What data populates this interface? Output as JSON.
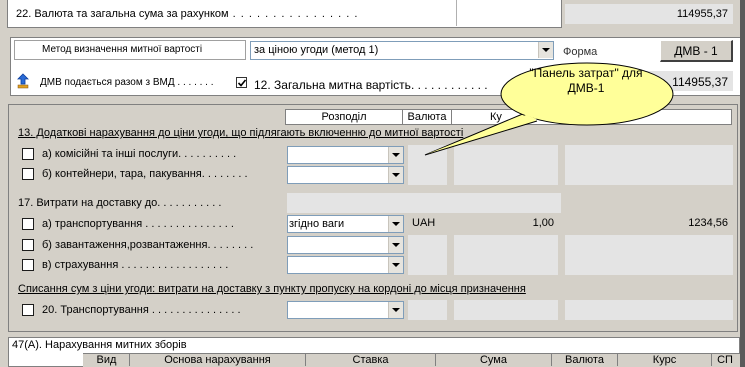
{
  "top": {
    "label22": "22. Валюта та загальна сума за рахунком",
    "total": "114955,37"
  },
  "method": {
    "label": "Метод визначення  митної вартості",
    "selected": "за ціною угоди (метод 1)",
    "form_label": "Форма",
    "form_button": "ДМВ - 1",
    "dmv_label": "ДМВ подається разом з ВМД",
    "label12": "12. Загальна митна вартість",
    "total12": "114955,37"
  },
  "tooltip": {
    "text": "\"Панель затрат\" для ДМВ-1"
  },
  "costs": {
    "headers": [
      "Розподіл",
      "Валюта",
      "Ку"
    ],
    "section13": "13. Додаткові нарахування до ціни угоди, що підлягають включенню до митної вартості",
    "rows13": [
      {
        "label": "а) комісійні та інші  послуги. . . . . . . . . ."
      },
      {
        "label": "б) контейнери, тара, пакування. . . . . . . ."
      }
    ],
    "section17": "17. Витрати на доставку до. . . . . . . . . . .",
    "rows17": [
      {
        "label": "а) транспортування . . . . . . . . . . . . . . .",
        "distribution": "згідно ваги",
        "currency": "UAH",
        "rate": "1,00",
        "amount": "1234,56"
      },
      {
        "label": "б) завантаження,розвантаження. . . . . . . ."
      },
      {
        "label": "в) страхування . . . . . . . . . . . . . . . . . ."
      }
    ],
    "section_write_off": "Списання сум з ціни угоди: витрати на доставку з пункту пропуску на кордоні до місця призначення",
    "row20": "20. Транспортування . . . . . . . . . . . . . . ."
  },
  "fees": {
    "title": "47(А). Нарахування митних зборів",
    "columns": [
      "Вид",
      "Основа нарахування",
      "Ставка",
      "Сума",
      "Валюта",
      "Курс",
      "СП"
    ]
  }
}
